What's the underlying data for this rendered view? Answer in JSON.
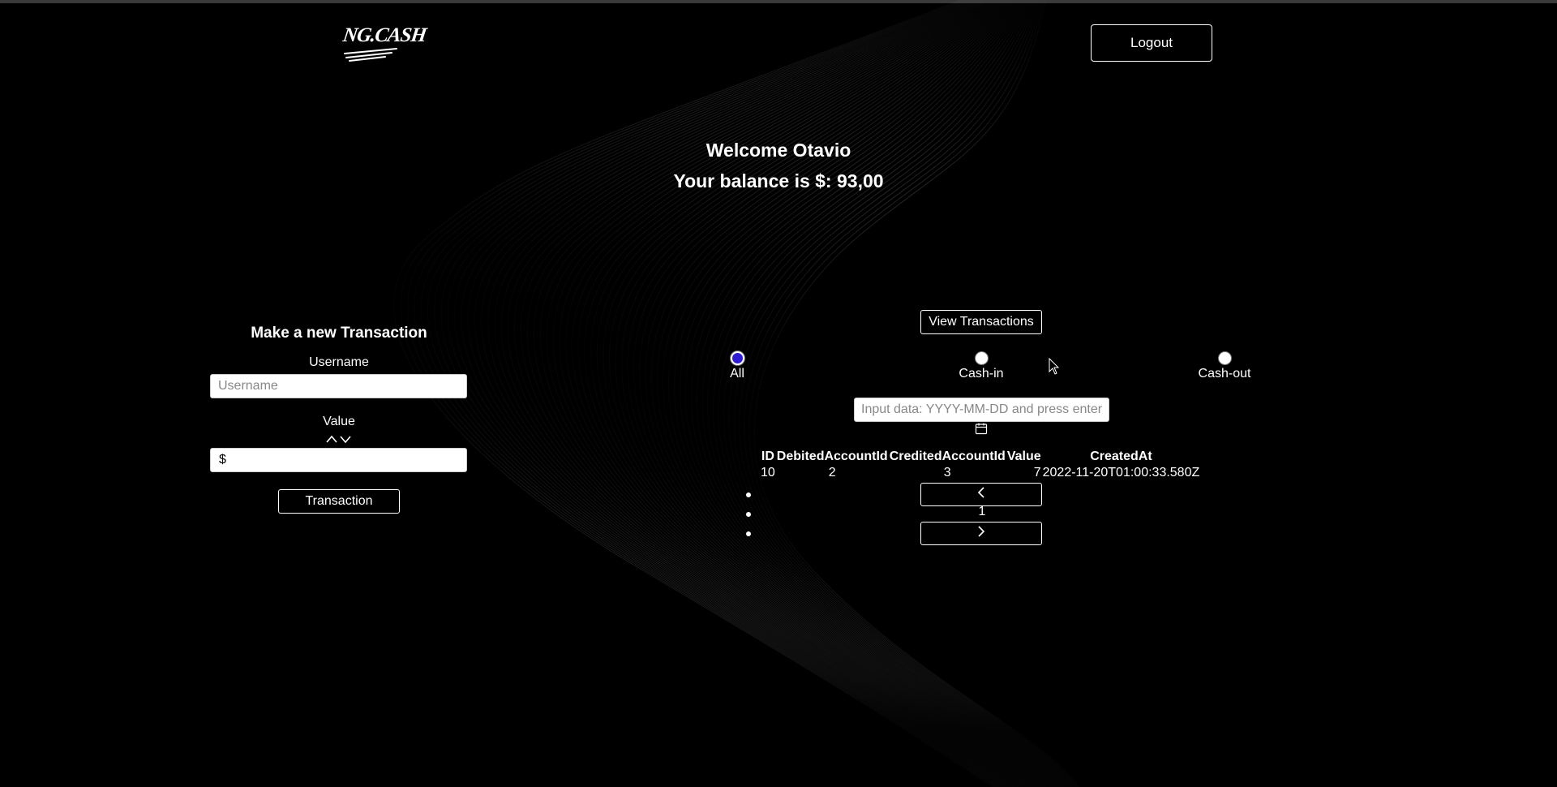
{
  "header": {
    "logo_text": "NG.CASH",
    "logout_label": "Logout"
  },
  "greeting": {
    "welcome": "Welcome Otavio",
    "balance": "Your balance is $: 93,00"
  },
  "new_transaction": {
    "title": "Make a new Transaction",
    "username_label": "Username",
    "username_placeholder": "Username",
    "value_label": "Value",
    "value_prefix": "$",
    "submit_label": "Transaction"
  },
  "transactions": {
    "view_label": "View Transactions",
    "filters": [
      {
        "label": "All",
        "checked": true
      },
      {
        "label": "Cash-in",
        "checked": false
      },
      {
        "label": "Cash-out",
        "checked": false
      }
    ],
    "date_placeholder": "Input data: YYYY-MM-DD and press enter",
    "table": {
      "headers": [
        "ID",
        "DebitedAccountId",
        "CreditedAccountId",
        "Value",
        "CreatedAt"
      ],
      "rows": [
        [
          "10",
          "2",
          "3",
          "7",
          "2022-11-20T01:00:33.580Z"
        ]
      ]
    },
    "pagination": {
      "prev_icon": "chevron-left-icon",
      "current_page": "1",
      "next_icon": "chevron-right-icon"
    }
  },
  "colors": {
    "background": "#000000",
    "foreground": "#ffffff",
    "radio_checked": "#2d1bd6"
  }
}
